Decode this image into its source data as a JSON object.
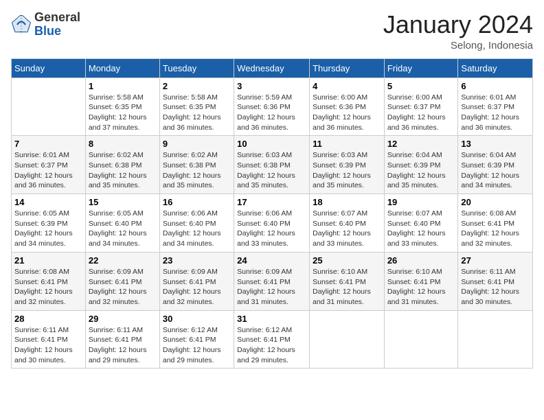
{
  "header": {
    "logo_general": "General",
    "logo_blue": "Blue",
    "month_year": "January 2024",
    "location": "Selong, Indonesia"
  },
  "weekdays": [
    "Sunday",
    "Monday",
    "Tuesday",
    "Wednesday",
    "Thursday",
    "Friday",
    "Saturday"
  ],
  "weeks": [
    [
      {
        "day": "",
        "sunrise": "",
        "sunset": "",
        "daylight": ""
      },
      {
        "day": "1",
        "sunrise": "Sunrise: 5:58 AM",
        "sunset": "Sunset: 6:35 PM",
        "daylight": "Daylight: 12 hours and 37 minutes."
      },
      {
        "day": "2",
        "sunrise": "Sunrise: 5:58 AM",
        "sunset": "Sunset: 6:35 PM",
        "daylight": "Daylight: 12 hours and 36 minutes."
      },
      {
        "day": "3",
        "sunrise": "Sunrise: 5:59 AM",
        "sunset": "Sunset: 6:36 PM",
        "daylight": "Daylight: 12 hours and 36 minutes."
      },
      {
        "day": "4",
        "sunrise": "Sunrise: 6:00 AM",
        "sunset": "Sunset: 6:36 PM",
        "daylight": "Daylight: 12 hours and 36 minutes."
      },
      {
        "day": "5",
        "sunrise": "Sunrise: 6:00 AM",
        "sunset": "Sunset: 6:37 PM",
        "daylight": "Daylight: 12 hours and 36 minutes."
      },
      {
        "day": "6",
        "sunrise": "Sunrise: 6:01 AM",
        "sunset": "Sunset: 6:37 PM",
        "daylight": "Daylight: 12 hours and 36 minutes."
      }
    ],
    [
      {
        "day": "7",
        "sunrise": "Sunrise: 6:01 AM",
        "sunset": "Sunset: 6:37 PM",
        "daylight": "Daylight: 12 hours and 36 minutes."
      },
      {
        "day": "8",
        "sunrise": "Sunrise: 6:02 AM",
        "sunset": "Sunset: 6:38 PM",
        "daylight": "Daylight: 12 hours and 35 minutes."
      },
      {
        "day": "9",
        "sunrise": "Sunrise: 6:02 AM",
        "sunset": "Sunset: 6:38 PM",
        "daylight": "Daylight: 12 hours and 35 minutes."
      },
      {
        "day": "10",
        "sunrise": "Sunrise: 6:03 AM",
        "sunset": "Sunset: 6:38 PM",
        "daylight": "Daylight: 12 hours and 35 minutes."
      },
      {
        "day": "11",
        "sunrise": "Sunrise: 6:03 AM",
        "sunset": "Sunset: 6:39 PM",
        "daylight": "Daylight: 12 hours and 35 minutes."
      },
      {
        "day": "12",
        "sunrise": "Sunrise: 6:04 AM",
        "sunset": "Sunset: 6:39 PM",
        "daylight": "Daylight: 12 hours and 35 minutes."
      },
      {
        "day": "13",
        "sunrise": "Sunrise: 6:04 AM",
        "sunset": "Sunset: 6:39 PM",
        "daylight": "Daylight: 12 hours and 34 minutes."
      }
    ],
    [
      {
        "day": "14",
        "sunrise": "Sunrise: 6:05 AM",
        "sunset": "Sunset: 6:39 PM",
        "daylight": "Daylight: 12 hours and 34 minutes."
      },
      {
        "day": "15",
        "sunrise": "Sunrise: 6:05 AM",
        "sunset": "Sunset: 6:40 PM",
        "daylight": "Daylight: 12 hours and 34 minutes."
      },
      {
        "day": "16",
        "sunrise": "Sunrise: 6:06 AM",
        "sunset": "Sunset: 6:40 PM",
        "daylight": "Daylight: 12 hours and 34 minutes."
      },
      {
        "day": "17",
        "sunrise": "Sunrise: 6:06 AM",
        "sunset": "Sunset: 6:40 PM",
        "daylight": "Daylight: 12 hours and 33 minutes."
      },
      {
        "day": "18",
        "sunrise": "Sunrise: 6:07 AM",
        "sunset": "Sunset: 6:40 PM",
        "daylight": "Daylight: 12 hours and 33 minutes."
      },
      {
        "day": "19",
        "sunrise": "Sunrise: 6:07 AM",
        "sunset": "Sunset: 6:40 PM",
        "daylight": "Daylight: 12 hours and 33 minutes."
      },
      {
        "day": "20",
        "sunrise": "Sunrise: 6:08 AM",
        "sunset": "Sunset: 6:41 PM",
        "daylight": "Daylight: 12 hours and 32 minutes."
      }
    ],
    [
      {
        "day": "21",
        "sunrise": "Sunrise: 6:08 AM",
        "sunset": "Sunset: 6:41 PM",
        "daylight": "Daylight: 12 hours and 32 minutes."
      },
      {
        "day": "22",
        "sunrise": "Sunrise: 6:09 AM",
        "sunset": "Sunset: 6:41 PM",
        "daylight": "Daylight: 12 hours and 32 minutes."
      },
      {
        "day": "23",
        "sunrise": "Sunrise: 6:09 AM",
        "sunset": "Sunset: 6:41 PM",
        "daylight": "Daylight: 12 hours and 32 minutes."
      },
      {
        "day": "24",
        "sunrise": "Sunrise: 6:09 AM",
        "sunset": "Sunset: 6:41 PM",
        "daylight": "Daylight: 12 hours and 31 minutes."
      },
      {
        "day": "25",
        "sunrise": "Sunrise: 6:10 AM",
        "sunset": "Sunset: 6:41 PM",
        "daylight": "Daylight: 12 hours and 31 minutes."
      },
      {
        "day": "26",
        "sunrise": "Sunrise: 6:10 AM",
        "sunset": "Sunset: 6:41 PM",
        "daylight": "Daylight: 12 hours and 31 minutes."
      },
      {
        "day": "27",
        "sunrise": "Sunrise: 6:11 AM",
        "sunset": "Sunset: 6:41 PM",
        "daylight": "Daylight: 12 hours and 30 minutes."
      }
    ],
    [
      {
        "day": "28",
        "sunrise": "Sunrise: 6:11 AM",
        "sunset": "Sunset: 6:41 PM",
        "daylight": "Daylight: 12 hours and 30 minutes."
      },
      {
        "day": "29",
        "sunrise": "Sunrise: 6:11 AM",
        "sunset": "Sunset: 6:41 PM",
        "daylight": "Daylight: 12 hours and 29 minutes."
      },
      {
        "day": "30",
        "sunrise": "Sunrise: 6:12 AM",
        "sunset": "Sunset: 6:41 PM",
        "daylight": "Daylight: 12 hours and 29 minutes."
      },
      {
        "day": "31",
        "sunrise": "Sunrise: 6:12 AM",
        "sunset": "Sunset: 6:41 PM",
        "daylight": "Daylight: 12 hours and 29 minutes."
      },
      {
        "day": "",
        "sunrise": "",
        "sunset": "",
        "daylight": ""
      },
      {
        "day": "",
        "sunrise": "",
        "sunset": "",
        "daylight": ""
      },
      {
        "day": "",
        "sunrise": "",
        "sunset": "",
        "daylight": ""
      }
    ]
  ]
}
